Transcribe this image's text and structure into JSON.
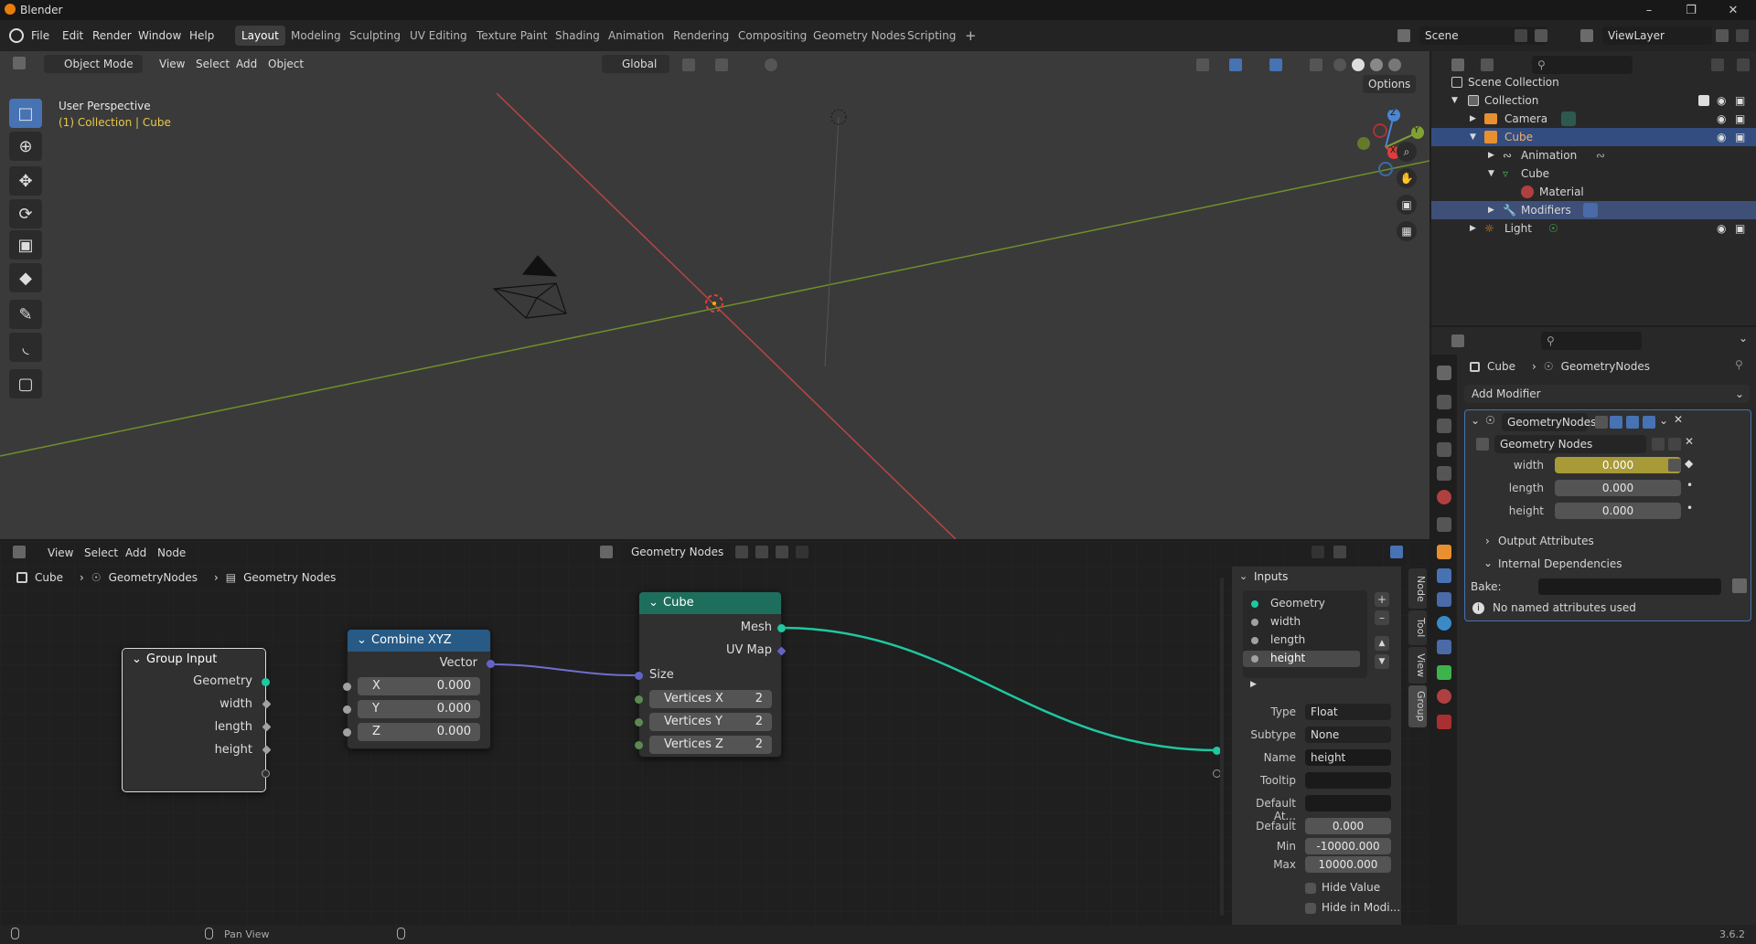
{
  "app": {
    "title": "Blender",
    "version": "3.6.2"
  },
  "menu": [
    "File",
    "Edit",
    "Render",
    "Window",
    "Help"
  ],
  "workspaces": [
    "Layout",
    "Modeling",
    "Sculpting",
    "UV Editing",
    "Texture Paint",
    "Shading",
    "Animation",
    "Rendering",
    "Compositing",
    "Geometry Nodes",
    "Scripting"
  ],
  "active_workspace": "Layout",
  "scene": {
    "name": "Scene",
    "view_layer": "ViewLayer"
  },
  "viewport": {
    "mode": "Object Mode",
    "menus": [
      "View",
      "Select",
      "Add",
      "Object"
    ],
    "transform_orientation": "Global",
    "options_label": "Options",
    "overlay_title": "User Perspective",
    "overlay_subtitle": "(1) Collection | Cube",
    "gizmo_axes": [
      "X",
      "Y",
      "Z"
    ],
    "colors": {
      "x_axis": "#d04a4a",
      "y_axis": "#7fa233",
      "grid_bg": "#3a3a3a"
    }
  },
  "node_editor": {
    "menus": [
      "View",
      "Select",
      "Add",
      "Node"
    ],
    "tree_name": "Geometry Nodes",
    "breadcrumb": [
      "Cube",
      "GeometryNodes",
      "Geometry Nodes"
    ],
    "side_tabs": [
      "Node",
      "Tool",
      "View",
      "Group"
    ],
    "nodes": {
      "group_input": {
        "title": "Group Input",
        "outputs": [
          "Geometry",
          "width",
          "length",
          "height"
        ]
      },
      "combine_xyz": {
        "title": "Combine XYZ",
        "output": "Vector",
        "inputs": [
          {
            "label": "X",
            "value": "0.000"
          },
          {
            "label": "Y",
            "value": "0.000"
          },
          {
            "label": "Z",
            "value": "0.000"
          }
        ]
      },
      "cube": {
        "title": "Cube",
        "outputs": [
          "Mesh",
          "UV Map"
        ],
        "size_label": "Size",
        "inputs": [
          {
            "label": "Vertices X",
            "value": "2"
          },
          {
            "label": "Vertices Y",
            "value": "2"
          },
          {
            "label": "Vertices Z",
            "value": "2"
          }
        ]
      }
    },
    "group_panel": {
      "section": "Inputs",
      "items": [
        "Geometry",
        "width",
        "length",
        "height"
      ],
      "selected": "height",
      "type_label": "Type",
      "type_value": "Float",
      "subtype_label": "Subtype",
      "subtype_value": "None",
      "name_label": "Name",
      "name_value": "height",
      "tooltip_label": "Tooltip",
      "tooltip_value": "",
      "default_attr_label": "Default At...",
      "default_attr_value": "",
      "default_label": "Default",
      "default_value": "0.000",
      "min_label": "Min",
      "min_value": "-10000.000",
      "max_label": "Max",
      "max_value": "10000.000",
      "hide_value_label": "Hide Value",
      "hide_in_modifier_label": "Hide in Modi..."
    }
  },
  "outliner": {
    "rows": [
      {
        "label": "Scene Collection",
        "indent": 0
      },
      {
        "label": "Collection",
        "indent": 1
      },
      {
        "label": "Camera",
        "indent": 2
      },
      {
        "label": "Cube",
        "indent": 2
      },
      {
        "label": "Animation",
        "indent": 3
      },
      {
        "label": "Cube",
        "indent": 3
      },
      {
        "label": "Material",
        "indent": 4
      },
      {
        "label": "Modifiers",
        "indent": 3
      },
      {
        "label": "Light",
        "indent": 2
      }
    ]
  },
  "properties": {
    "breadcrumb": [
      "Cube",
      "GeometryNodes"
    ],
    "add_modifier": "Add Modifier",
    "modifier_name": "GeometryNodes",
    "node_group": "Geometry Nodes",
    "params": [
      {
        "label": "width",
        "value": "0.000"
      },
      {
        "label": "length",
        "value": "0.000"
      },
      {
        "label": "height",
        "value": "0.000"
      }
    ],
    "output_attributes": "Output Attributes",
    "internal_dependencies": "Internal Dependencies",
    "bake_label": "Bake:",
    "info": "No named attributes used"
  },
  "statusbar": {
    "hint": "Pan View"
  }
}
